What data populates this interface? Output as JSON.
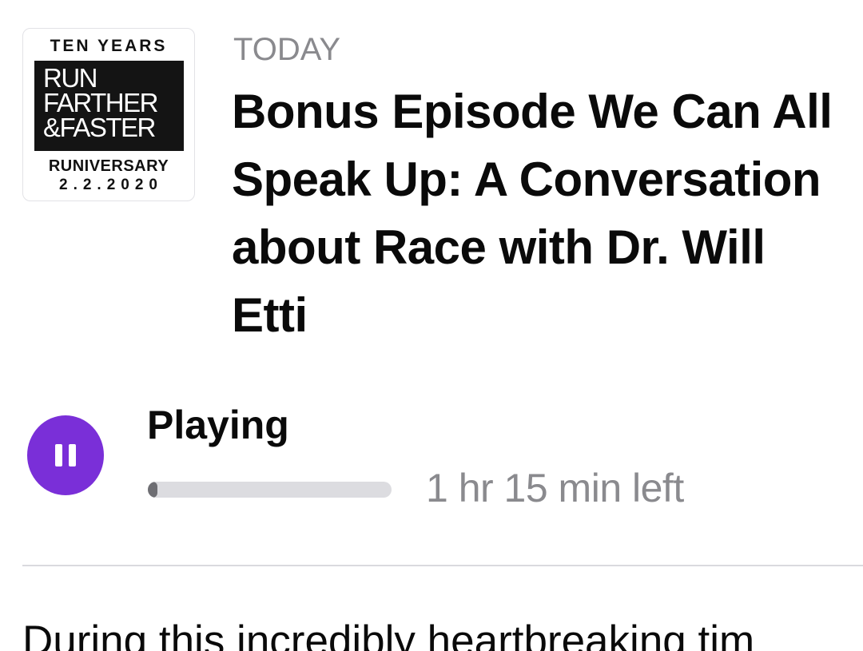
{
  "artwork": {
    "top_text": "TEN YEARS",
    "box_lines": [
      "RUN",
      "FARTHER",
      "&FASTER"
    ],
    "anniversary_text": "RUNIVERSARY",
    "date_text": "2.2.2020"
  },
  "episode": {
    "date_label": "TODAY",
    "title": "Bonus Episode We Can All Speak Up: A Conversation about Race with Dr. Will Etti"
  },
  "playback": {
    "status": "Playing",
    "time_left": "1 hr 15 min left",
    "progress_fraction": 0.04,
    "accent_color": "#7a2fd8",
    "button_icon": "pause-icon"
  },
  "description": {
    "text": "During this incredibly heartbreaking tim"
  }
}
